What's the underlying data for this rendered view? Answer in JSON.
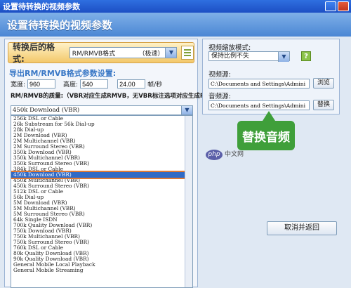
{
  "window": {
    "title": "设置待转换的视频参数"
  },
  "header": {
    "title": "设置待转换的视频参数"
  },
  "format": {
    "label": "转换后的格式:",
    "selected": "RM/RMVB格式",
    "tag": "（极速）"
  },
  "params": {
    "title": "导出RM/RMVB格式参数设置:",
    "width_label": "宽度:",
    "width_value": "960",
    "height_label": "高度:",
    "height_value": "540",
    "fps_value": "24.00",
    "fps_unit": "帧/秒",
    "quality_label": "RM/RMVB的质量:（VBR对应生成RMVB，无VBR标注选项对应生成RM）",
    "quality_selected": "450k Download (VBR)"
  },
  "quality_options": [
    "256k DSL or Cable",
    "26k Substream for 56k Dial-up",
    "28k Dial-up",
    "2M Download (VBR)",
    "2M Multichannel (VBR)",
    "2M Surround Stereo (VBR)",
    "350k Download (VBR)",
    "350k Multichannel (VBR)",
    "350k Surround Stereo (VBR)",
    "384k DSL or Cable",
    "450k Download (VBR)",
    "450k Multichannel (VBR)",
    "450k Surround Stereo (VBR)",
    "512k DSL or Cable",
    "56k Dial-up",
    "5M Download (VBR)",
    "5M Multichannel (VBR)",
    "5M Surround Stereo (VBR)",
    "64k Single ISDN",
    "700k Quality Download (VBR)",
    "750k Download (VBR)",
    "750k Multichannel (VBR)",
    "750k Surround Stereo (VBR)",
    "760k DSL or Cable",
    "80k Quality Download (VBR)",
    "90k Quality Download (VBR)",
    "General Mobile Local Playback",
    "General Mobile Streaming"
  ],
  "right_panel": {
    "scale_mode_label": "视频缩放模式:",
    "scale_mode_value": "保持比例不失",
    "help_icon": "?",
    "video_source_label": "视频源:",
    "video_source_path": "C:\\Documents and Settings\\Admini",
    "browse_label": "浏览",
    "audio_source_label": "音频源:",
    "audio_source_path": "C:\\Documents and Settings\\Admini",
    "replace_label": "替换"
  },
  "callout": {
    "text": "替换音频"
  },
  "watermark": {
    "logo": "php",
    "text": "中文网"
  },
  "footer": {
    "close_label": "取消并返回"
  }
}
